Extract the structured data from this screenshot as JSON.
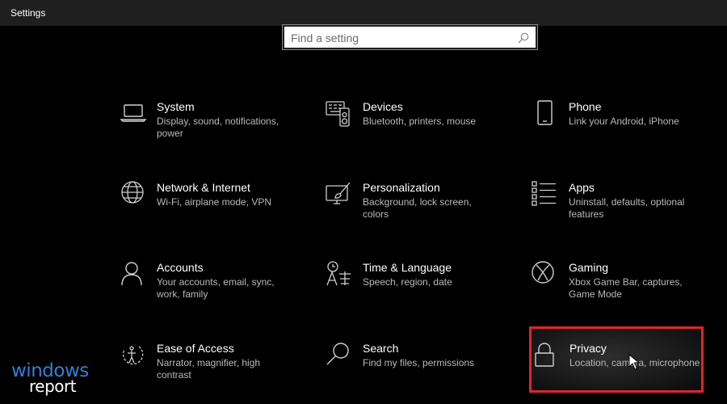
{
  "window": {
    "title": "Settings"
  },
  "search": {
    "placeholder": "Find a setting",
    "value": ""
  },
  "tiles": [
    {
      "title": "System",
      "desc": "Display, sound, notifications, power",
      "icon": "laptop-icon"
    },
    {
      "title": "Devices",
      "desc": "Bluetooth, printers, mouse",
      "icon": "devices-icon"
    },
    {
      "title": "Phone",
      "desc": "Link your Android, iPhone",
      "icon": "phone-icon"
    },
    {
      "title": "Network & Internet",
      "desc": "Wi-Fi, airplane mode, VPN",
      "icon": "globe-icon"
    },
    {
      "title": "Personalization",
      "desc": "Background, lock screen, colors",
      "icon": "paintbrush-icon"
    },
    {
      "title": "Apps",
      "desc": "Uninstall, defaults, optional features",
      "icon": "apps-list-icon"
    },
    {
      "title": "Accounts",
      "desc": "Your accounts, email, sync, work, family",
      "icon": "person-icon"
    },
    {
      "title": "Time & Language",
      "desc": "Speech, region, date",
      "icon": "time-language-icon"
    },
    {
      "title": "Gaming",
      "desc": "Xbox Game Bar, captures, Game Mode",
      "icon": "xbox-icon"
    },
    {
      "title": "Ease of Access",
      "desc": "Narrator, magnifier, high contrast",
      "icon": "ease-of-access-icon"
    },
    {
      "title": "Search",
      "desc": "Find my files, permissions",
      "icon": "magnifier-icon"
    },
    {
      "title": "Privacy",
      "desc": "Location, camera, microphone",
      "icon": "lock-icon"
    }
  ],
  "highlight": {
    "target": "Privacy",
    "color": "#e3242b"
  },
  "watermark": {
    "line1": "windows",
    "line2": "report"
  },
  "colors": {
    "background": "#000000",
    "titlebar": "#1f1f1f",
    "desc_text": "#b9b9b9",
    "watermark_blue": "#2f7fd8"
  }
}
